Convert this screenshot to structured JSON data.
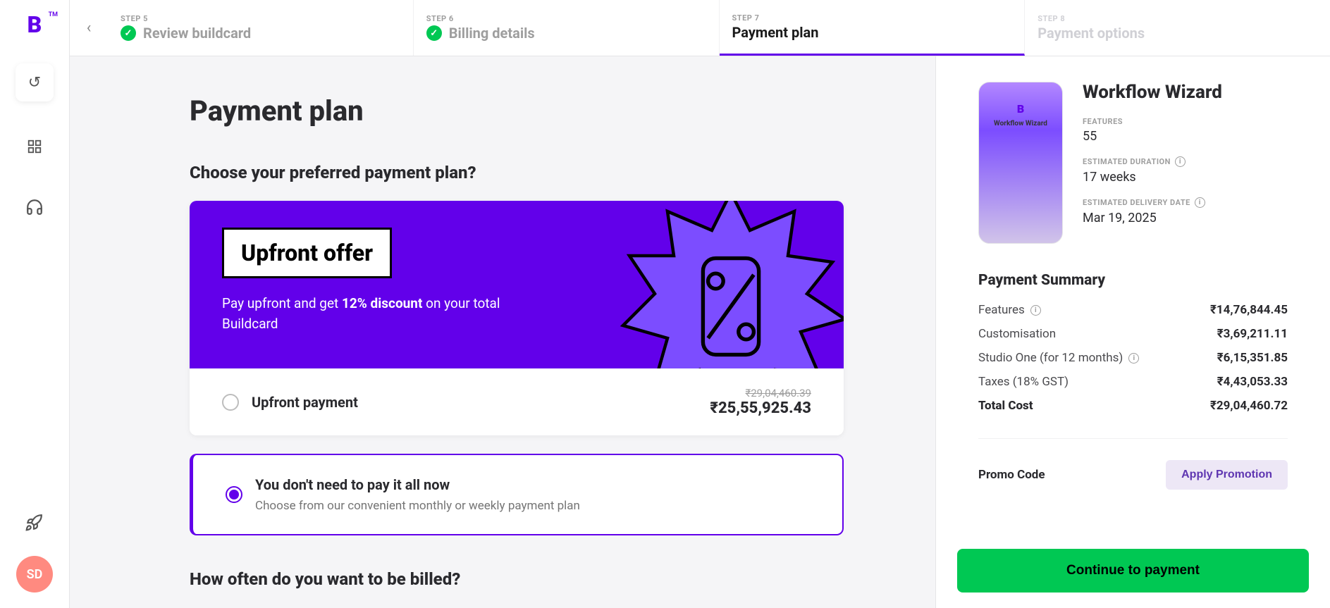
{
  "sidebar": {
    "logo_text": "B",
    "logo_tm": "TM",
    "avatar_initials": "SD"
  },
  "stepper": {
    "steps": [
      {
        "num": "STEP 5",
        "title": "Review buildcard",
        "completed": true,
        "active": false,
        "future": false
      },
      {
        "num": "STEP 6",
        "title": "Billing details",
        "completed": true,
        "active": false,
        "future": false
      },
      {
        "num": "STEP 7",
        "title": "Payment plan",
        "completed": false,
        "active": true,
        "future": false
      },
      {
        "num": "STEP 8",
        "title": "Payment options",
        "completed": false,
        "active": false,
        "future": true
      }
    ]
  },
  "page": {
    "title": "Payment plan",
    "section1_heading": "Choose your preferred payment plan?",
    "section2_heading": "How often do you want to be billed?"
  },
  "offer": {
    "badge": "Upfront offer",
    "desc_pre": "Pay upfront and get ",
    "desc_bold": "12% discount",
    "desc_post": " on your total Buildcard",
    "option_label": "Upfront payment",
    "price_original": "₹29,04,460.39",
    "price_discounted": "₹25,55,925.43"
  },
  "flex_option": {
    "title": "You don't need to pay it all now",
    "subtitle": "Choose from our convenient monthly or weekly payment plan"
  },
  "product": {
    "name": "Workflow Wizard",
    "thumb_name": "Workflow Wizard",
    "features_label": "FEATURES",
    "features_value": "55",
    "duration_label": "ESTIMATED DURATION",
    "duration_value": "17 weeks",
    "delivery_label": "ESTIMATED DELIVERY DATE",
    "delivery_value": "Mar 19, 2025"
  },
  "summary": {
    "title": "Payment Summary",
    "lines": [
      {
        "label": "Features",
        "info": true,
        "value": "₹14,76,844.45"
      },
      {
        "label": "Customisation",
        "info": false,
        "value": "₹3,69,211.11"
      },
      {
        "label": "Studio One (for 12 months)",
        "info": true,
        "value": "₹6,15,351.85"
      },
      {
        "label": "Taxes (18% GST)",
        "info": false,
        "value": "₹4,43,053.33"
      }
    ],
    "total_label": "Total Cost",
    "total_value": "₹29,04,460.72"
  },
  "promo": {
    "label": "Promo Code",
    "button": "Apply Promotion"
  },
  "cta": {
    "continue": "Continue to payment"
  }
}
